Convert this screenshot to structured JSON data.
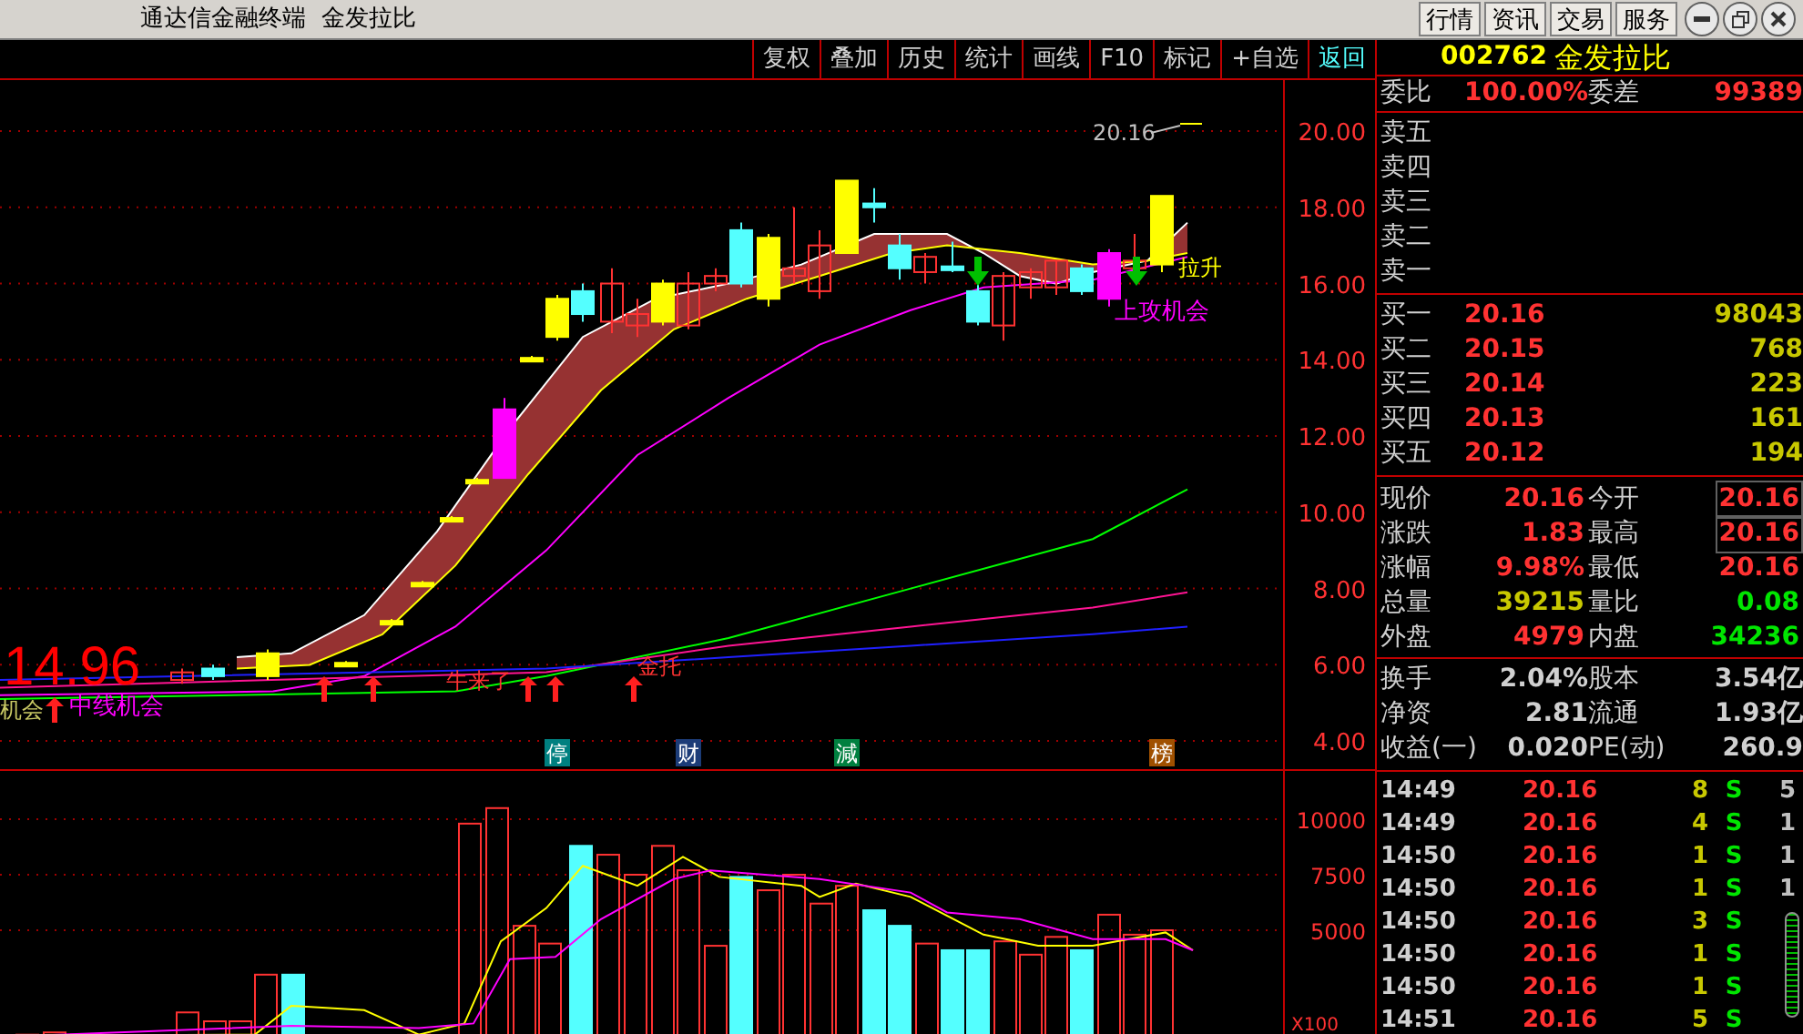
{
  "window": {
    "title": "通达信金融终端  金发拉比",
    "menu_buttons": [
      "行情",
      "资讯",
      "交易",
      "服务"
    ]
  },
  "toolbar": [
    {
      "label": "复权",
      "highlighted": false
    },
    {
      "label": "叠加",
      "highlighted": false
    },
    {
      "label": "历史",
      "highlighted": false
    },
    {
      "label": "统计",
      "highlighted": false
    },
    {
      "label": "画线",
      "highlighted": false
    },
    {
      "label": "F10",
      "highlighted": false
    },
    {
      "label": "标记",
      "highlighted": false
    },
    {
      "label": "+自选",
      "highlighted": false
    },
    {
      "label": "返回",
      "highlighted": true
    }
  ],
  "price_chart": {
    "price_axis": [
      "20.00",
      "18.00",
      "16.00",
      "14.00",
      "12.00",
      "10.00",
      "8.00",
      "6.00",
      "4.00"
    ],
    "latest_price_label": "20.16",
    "big_price_label": "14.96",
    "signals": [
      {
        "text": "机会",
        "color": "#c8c864"
      },
      {
        "text": "中线机会",
        "color": "#ff00ff"
      },
      {
        "text": "牛来了",
        "color": "#ff3232"
      },
      {
        "text": "金托",
        "color": "#ff3232"
      },
      {
        "text": "拉升",
        "color": "#ffff00"
      },
      {
        "text": "上攻机会",
        "color": "#ff00ff"
      }
    ],
    "event_markers": [
      {
        "text": "停",
        "color": "#008080"
      },
      {
        "text": "财",
        "color": "#1c3c78"
      },
      {
        "text": "減",
        "color": "#008040"
      },
      {
        "text": "榜",
        "color": "#a05000"
      }
    ]
  },
  "volume_chart": {
    "axis": [
      "10000",
      "7500",
      "5000"
    ],
    "unit": "X100"
  },
  "quote": {
    "code": "002762",
    "name": "金发拉比",
    "order_ratio": {
      "label": "委比",
      "value": "100.00%",
      "label2": "委差",
      "value2": "99389"
    },
    "sell_levels": [
      {
        "label": "卖五"
      },
      {
        "label": "卖四"
      },
      {
        "label": "卖三"
      },
      {
        "label": "卖二"
      },
      {
        "label": "卖一"
      }
    ],
    "buy_levels": [
      {
        "label": "买一",
        "price": "20.16",
        "volume": "98043"
      },
      {
        "label": "买二",
        "price": "20.15",
        "volume": "768"
      },
      {
        "label": "买三",
        "price": "20.14",
        "volume": "223"
      },
      {
        "label": "买四",
        "price": "20.13",
        "volume": "161"
      },
      {
        "label": "买五",
        "price": "20.12",
        "volume": "194"
      }
    ],
    "stats": [
      {
        "cells": [
          {
            "label": "现价",
            "value": "20.16",
            "color": "#ff3232",
            "boxed": false
          },
          {
            "label": "今开",
            "value": "20.16",
            "color": "#ff3232",
            "boxed": true
          }
        ]
      },
      {
        "cells": [
          {
            "label": "涨跌",
            "value": "1.83",
            "color": "#ff3232",
            "boxed": false
          },
          {
            "label": "最高",
            "value": "20.16",
            "color": "#ff3232",
            "boxed": true
          }
        ]
      },
      {
        "cells": [
          {
            "label": "涨幅",
            "value": "9.98%",
            "color": "#ff3232",
            "boxed": false
          },
          {
            "label": "最低",
            "value": "20.16",
            "color": "#ff3232",
            "boxed": false
          }
        ]
      },
      {
        "cells": [
          {
            "label": "总量",
            "value": "39215",
            "color": "#c8c800",
            "boxed": false
          },
          {
            "label": "量比",
            "value": "0.08",
            "color": "#00e600",
            "boxed": false
          }
        ]
      },
      {
        "cells": [
          {
            "label": "外盘",
            "value": "4979",
            "color": "#ff3232",
            "boxed": false
          },
          {
            "label": "内盘",
            "value": "34236",
            "color": "#00e600",
            "boxed": false
          }
        ]
      }
    ],
    "fundamentals": [
      {
        "label": "换手",
        "value": "2.04%",
        "label2": "股本",
        "value2": "3.54亿"
      },
      {
        "label": "净资",
        "value": "2.81",
        "label2": "流通",
        "value2": "1.93亿"
      },
      {
        "label": "收益(一)",
        "value": "0.020",
        "label2": "PE(动)",
        "value2": "260.9"
      }
    ],
    "trades": [
      {
        "time": "14:49",
        "price": "20.16",
        "volume": "8",
        "side": "S",
        "count": "5"
      },
      {
        "time": "14:49",
        "price": "20.16",
        "volume": "4",
        "side": "S",
        "count": "1"
      },
      {
        "time": "14:50",
        "price": "20.16",
        "volume": "1",
        "side": "S",
        "count": "1"
      },
      {
        "time": "14:50",
        "price": "20.16",
        "volume": "1",
        "side": "S",
        "count": "1"
      },
      {
        "time": "14:50",
        "price": "20.16",
        "volume": "3",
        "side": "S"
      },
      {
        "time": "14:50",
        "price": "20.16",
        "volume": "1",
        "side": "S"
      },
      {
        "time": "14:50",
        "price": "20.16",
        "volume": "1",
        "side": "S"
      },
      {
        "time": "14:51",
        "price": "20.16",
        "volume": "5",
        "side": "S"
      }
    ]
  }
}
